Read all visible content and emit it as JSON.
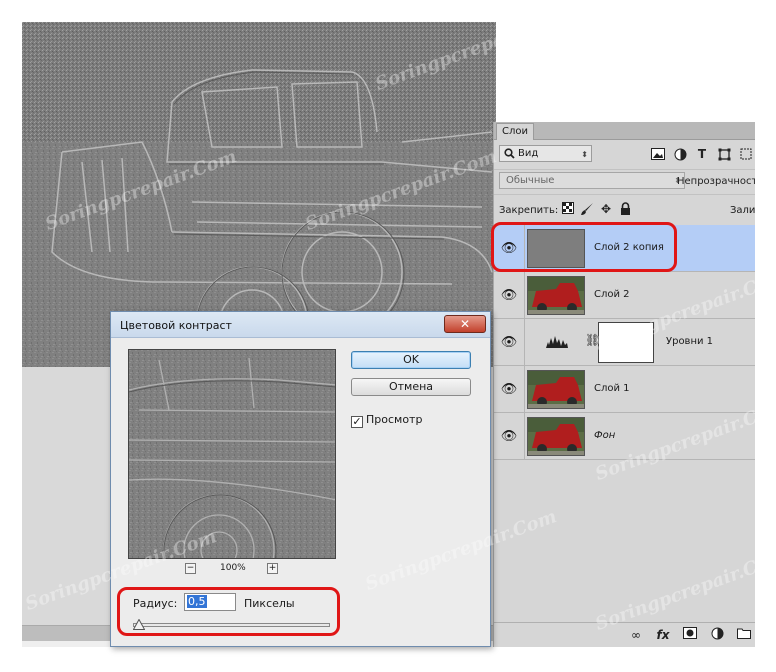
{
  "colors": {
    "selection": "#b4cdf6",
    "highlight": "#e01616",
    "ok_border": "#3c7fb1"
  },
  "layers_panel": {
    "tab_label": "Слои",
    "filter": {
      "kind_value": "Вид",
      "icons": [
        "image-filter-icon",
        "adjustment-filter-icon",
        "type-filter-icon",
        "shape-filter-icon"
      ]
    },
    "blend_mode": "Обычные",
    "opacity_label": "Непрозрачность:",
    "lock_label": "Закрепить:",
    "fill_label": "Залив",
    "layers": [
      {
        "name": "Слой 2 копия",
        "selected": true,
        "visible": true,
        "type": "gray"
      },
      {
        "name": "Слой 2",
        "selected": false,
        "visible": true,
        "type": "photo"
      },
      {
        "name": "Уровни 1",
        "selected": false,
        "visible": true,
        "type": "adjustment"
      },
      {
        "name": "Слой 1",
        "selected": false,
        "visible": true,
        "type": "photo"
      },
      {
        "name": "Фон",
        "selected": false,
        "visible": true,
        "type": "photo",
        "italic": true
      }
    ]
  },
  "dialog": {
    "title": "Цветовой контраст",
    "close_symbol": "✕",
    "zoom_out": "−",
    "zoom_level": "100%",
    "zoom_in": "+",
    "ok_label": "OK",
    "cancel_label": "Отмена",
    "preview_label": "Просмотр",
    "preview_checked": true,
    "radius_label": "Радиус:",
    "radius_value": "0,5",
    "radius_unit": "Пикселы"
  },
  "watermark": "Soringpcrepair.Com"
}
